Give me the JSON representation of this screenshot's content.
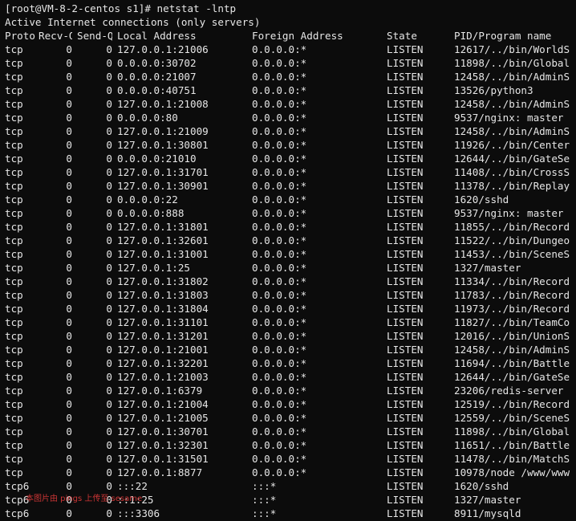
{
  "terminal": {
    "prompt": "[root@VM-8-2-centos s1]# netstat -lntp",
    "info": "Active Internet connections (only servers)",
    "headers": {
      "proto": "Proto",
      "recvq": "Recv-Q",
      "sendq": "Send-Q",
      "local": "Local Address",
      "foreign": "Foreign Address",
      "state": "State",
      "pid": "PID/Program name"
    },
    "rows": [
      {
        "proto": "tcp",
        "recvq": "0",
        "sendq": "0",
        "local": "127.0.0.1:21006",
        "foreign": "0.0.0.0:*",
        "state": "LISTEN",
        "pid": "12617/../bin/WorldS"
      },
      {
        "proto": "tcp",
        "recvq": "0",
        "sendq": "0",
        "local": "0.0.0.0:30702",
        "foreign": "0.0.0.0:*",
        "state": "LISTEN",
        "pid": "11898/../bin/Global"
      },
      {
        "proto": "tcp",
        "recvq": "0",
        "sendq": "0",
        "local": "0.0.0.0:21007",
        "foreign": "0.0.0.0:*",
        "state": "LISTEN",
        "pid": "12458/../bin/AdminS"
      },
      {
        "proto": "tcp",
        "recvq": "0",
        "sendq": "0",
        "local": "0.0.0.0:40751",
        "foreign": "0.0.0.0:*",
        "state": "LISTEN",
        "pid": "13526/python3"
      },
      {
        "proto": "tcp",
        "recvq": "0",
        "sendq": "0",
        "local": "127.0.0.1:21008",
        "foreign": "0.0.0.0:*",
        "state": "LISTEN",
        "pid": "12458/../bin/AdminS"
      },
      {
        "proto": "tcp",
        "recvq": "0",
        "sendq": "0",
        "local": "0.0.0.0:80",
        "foreign": "0.0.0.0:*",
        "state": "LISTEN",
        "pid": "9537/nginx: master"
      },
      {
        "proto": "tcp",
        "recvq": "0",
        "sendq": "0",
        "local": "127.0.0.1:21009",
        "foreign": "0.0.0.0:*",
        "state": "LISTEN",
        "pid": "12458/../bin/AdminS"
      },
      {
        "proto": "tcp",
        "recvq": "0",
        "sendq": "0",
        "local": "127.0.0.1:30801",
        "foreign": "0.0.0.0:*",
        "state": "LISTEN",
        "pid": "11926/../bin/Center"
      },
      {
        "proto": "tcp",
        "recvq": "0",
        "sendq": "0",
        "local": "0.0.0.0:21010",
        "foreign": "0.0.0.0:*",
        "state": "LISTEN",
        "pid": "12644/../bin/GateSe"
      },
      {
        "proto": "tcp",
        "recvq": "0",
        "sendq": "0",
        "local": "127.0.0.1:31701",
        "foreign": "0.0.0.0:*",
        "state": "LISTEN",
        "pid": "11408/../bin/CrossS"
      },
      {
        "proto": "tcp",
        "recvq": "0",
        "sendq": "0",
        "local": "127.0.0.1:30901",
        "foreign": "0.0.0.0:*",
        "state": "LISTEN",
        "pid": "11378/../bin/Replay"
      },
      {
        "proto": "tcp",
        "recvq": "0",
        "sendq": "0",
        "local": "0.0.0.0:22",
        "foreign": "0.0.0.0:*",
        "state": "LISTEN",
        "pid": "1620/sshd"
      },
      {
        "proto": "tcp",
        "recvq": "0",
        "sendq": "0",
        "local": "0.0.0.0:888",
        "foreign": "0.0.0.0:*",
        "state": "LISTEN",
        "pid": "9537/nginx: master"
      },
      {
        "proto": "tcp",
        "recvq": "0",
        "sendq": "0",
        "local": "127.0.0.1:31801",
        "foreign": "0.0.0.0:*",
        "state": "LISTEN",
        "pid": "11855/../bin/Record"
      },
      {
        "proto": "tcp",
        "recvq": "0",
        "sendq": "0",
        "local": "127.0.0.1:32601",
        "foreign": "0.0.0.0:*",
        "state": "LISTEN",
        "pid": "11522/../bin/Dungeo"
      },
      {
        "proto": "tcp",
        "recvq": "0",
        "sendq": "0",
        "local": "127.0.0.1:31001",
        "foreign": "0.0.0.0:*",
        "state": "LISTEN",
        "pid": "11453/../bin/SceneS"
      },
      {
        "proto": "tcp",
        "recvq": "0",
        "sendq": "0",
        "local": "127.0.0.1:25",
        "foreign": "0.0.0.0:*",
        "state": "LISTEN",
        "pid": "1327/master"
      },
      {
        "proto": "tcp",
        "recvq": "0",
        "sendq": "0",
        "local": "127.0.0.1:31802",
        "foreign": "0.0.0.0:*",
        "state": "LISTEN",
        "pid": "11334/../bin/Record"
      },
      {
        "proto": "tcp",
        "recvq": "0",
        "sendq": "0",
        "local": "127.0.0.1:31803",
        "foreign": "0.0.0.0:*",
        "state": "LISTEN",
        "pid": "11783/../bin/Record"
      },
      {
        "proto": "tcp",
        "recvq": "0",
        "sendq": "0",
        "local": "127.0.0.1:31804",
        "foreign": "0.0.0.0:*",
        "state": "LISTEN",
        "pid": "11973/../bin/Record"
      },
      {
        "proto": "tcp",
        "recvq": "0",
        "sendq": "0",
        "local": "127.0.0.1:31101",
        "foreign": "0.0.0.0:*",
        "state": "LISTEN",
        "pid": "11827/../bin/TeamCo"
      },
      {
        "proto": "tcp",
        "recvq": "0",
        "sendq": "0",
        "local": "127.0.0.1:31201",
        "foreign": "0.0.0.0:*",
        "state": "LISTEN",
        "pid": "12016/../bin/UnionS"
      },
      {
        "proto": "tcp",
        "recvq": "0",
        "sendq": "0",
        "local": "127.0.0.1:21001",
        "foreign": "0.0.0.0:*",
        "state": "LISTEN",
        "pid": "12458/../bin/AdminS"
      },
      {
        "proto": "tcp",
        "recvq": "0",
        "sendq": "0",
        "local": "127.0.0.1:32201",
        "foreign": "0.0.0.0:*",
        "state": "LISTEN",
        "pid": "11694/../bin/Battle"
      },
      {
        "proto": "tcp",
        "recvq": "0",
        "sendq": "0",
        "local": "127.0.0.1:21003",
        "foreign": "0.0.0.0:*",
        "state": "LISTEN",
        "pid": "12644/../bin/GateSe"
      },
      {
        "proto": "tcp",
        "recvq": "0",
        "sendq": "0",
        "local": "127.0.0.1:6379",
        "foreign": "0.0.0.0:*",
        "state": "LISTEN",
        "pid": "23206/redis-server"
      },
      {
        "proto": "tcp",
        "recvq": "0",
        "sendq": "0",
        "local": "127.0.0.1:21004",
        "foreign": "0.0.0.0:*",
        "state": "LISTEN",
        "pid": "12519/../bin/Record"
      },
      {
        "proto": "tcp",
        "recvq": "0",
        "sendq": "0",
        "local": "127.0.0.1:21005",
        "foreign": "0.0.0.0:*",
        "state": "LISTEN",
        "pid": "12559/../bin/SceneS"
      },
      {
        "proto": "tcp",
        "recvq": "0",
        "sendq": "0",
        "local": "127.0.0.1:30701",
        "foreign": "0.0.0.0:*",
        "state": "LISTEN",
        "pid": "11898/../bin/Global"
      },
      {
        "proto": "tcp",
        "recvq": "0",
        "sendq": "0",
        "local": "127.0.0.1:32301",
        "foreign": "0.0.0.0:*",
        "state": "LISTEN",
        "pid": "11651/../bin/Battle"
      },
      {
        "proto": "tcp",
        "recvq": "0",
        "sendq": "0",
        "local": "127.0.0.1:31501",
        "foreign": "0.0.0.0:*",
        "state": "LISTEN",
        "pid": "11478/../bin/MatchS"
      },
      {
        "proto": "tcp",
        "recvq": "0",
        "sendq": "0",
        "local": "127.0.0.1:8877",
        "foreign": "0.0.0.0:*",
        "state": "LISTEN",
        "pid": "10978/node /www/www"
      },
      {
        "proto": "tcp6",
        "recvq": "0",
        "sendq": "0",
        "local": ":::22",
        "foreign": ":::*",
        "state": "LISTEN",
        "pid": "1620/sshd"
      },
      {
        "proto": "tcp6",
        "recvq": "0",
        "sendq": "0",
        "local": "::1:25",
        "foreign": ":::*",
        "state": "LISTEN",
        "pid": "1327/master"
      },
      {
        "proto": "tcp6",
        "recvq": "0",
        "sendq": "0",
        "local": ":::3306",
        "foreign": ":::*",
        "state": "LISTEN",
        "pid": "8911/mysqld"
      }
    ],
    "watermark": "本图片由 pings 上传至 sesame"
  },
  "colors": {
    "background": "#0c0c0c",
    "text": "#e6e6e6",
    "watermark": "#e03a3a"
  }
}
